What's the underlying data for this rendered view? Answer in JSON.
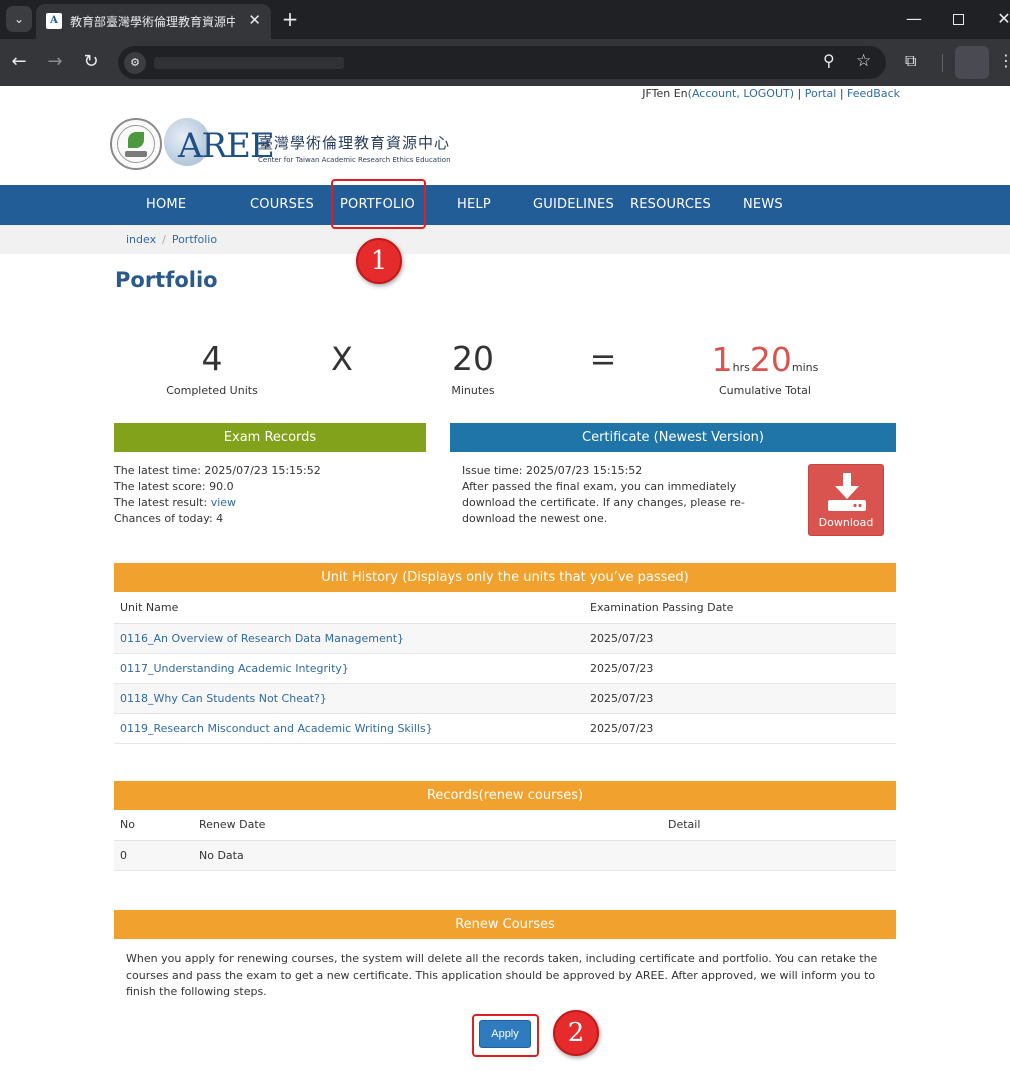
{
  "browser": {
    "tab_title": "教育部臺灣學術倫理教育資源中",
    "tab_close": "✕",
    "new_tab": "+",
    "minimize": "—",
    "close": "✕"
  },
  "userbar": {
    "name": "JFTen En",
    "account": "Account",
    "logout": "LOGOUT",
    "portal": "Portal",
    "feedback": "FeedBack"
  },
  "logo": {
    "aree": "AREE",
    "chinese": "臺灣學術倫理教育資源中心",
    "english": "Center for Taiwan Academic Research Ethics Education"
  },
  "nav": {
    "home": "HOME",
    "courses": "COURSES",
    "portfolio": "PORTFOLIO",
    "help": "HELP",
    "guidelines": "GUIDELINES",
    "resources": "RESOURCES",
    "news": "NEWS"
  },
  "breadcrumb": {
    "index": "index",
    "separator": "/",
    "current": "Portfolio"
  },
  "page_title": "Portfolio",
  "stats": {
    "units": "4",
    "units_label": "Completed Units",
    "times": "X",
    "minutes": "20",
    "minutes_label": "Minutes",
    "equals": "=",
    "hrs": "1",
    "hrs_unit": "hrs",
    "mins": "20",
    "mins_unit": "mins",
    "total_label": "Cumulative Total"
  },
  "exam": {
    "header": "Exam Records",
    "latest_time": "The latest time: 2025/07/23 15:15:52",
    "latest_score": "The latest score: 90.0",
    "latest_result_label": "The latest result:",
    "latest_result_link": "view",
    "chances": "Chances of today: 4"
  },
  "certificate": {
    "header": "Certificate (Newest Version)",
    "issue_time": "Issue time: 2025/07/23 15:15:52",
    "line1": "After passed the final exam, you can immediately",
    "line2": "download the certificate. If any changes, please re-",
    "line3": "download the newest one.",
    "download_label": "Download"
  },
  "unit_history": {
    "header": "Unit History (Displays only the units that you’ve passed)",
    "columns": [
      "Unit Name",
      "Examination Passing Date"
    ],
    "rows": [
      {
        "name": "0116_An Overview of Research Data Management}",
        "date": "2025/07/23"
      },
      {
        "name": "0117_Understanding Academic Integrity}",
        "date": "2025/07/23"
      },
      {
        "name": "0118_Why Can Students Not Cheat?}",
        "date": "2025/07/23"
      },
      {
        "name": "0119_Research Misconduct and Academic Writing Skills}",
        "date": "2025/07/23"
      }
    ]
  },
  "renew_records": {
    "header": "Records(renew courses)",
    "columns": [
      "No",
      "Renew Date",
      "Detail"
    ],
    "rows": [
      {
        "no": "0",
        "date": "No Data",
        "detail": ""
      }
    ]
  },
  "renew_courses": {
    "header": "Renew Courses",
    "text": "When you apply for renewing courses, the system will delete all the records taken, including certificate and portfolio. You can retake the courses and pass the exam to get a new certificate. This application should be approved by AREE. After approved, we will inform you to finish the following steps.",
    "apply_label": "Apply"
  },
  "annotations": {
    "step1": "1",
    "step2": "2",
    "color": "#e02020"
  },
  "colors": {
    "nav_blue": "#235d98",
    "exam_green": "#83a21b",
    "cert_blue": "#1f74a8",
    "section_orange": "#f0a12e",
    "download_red": "#d9534f",
    "apply_blue": "#2e7bbf"
  }
}
